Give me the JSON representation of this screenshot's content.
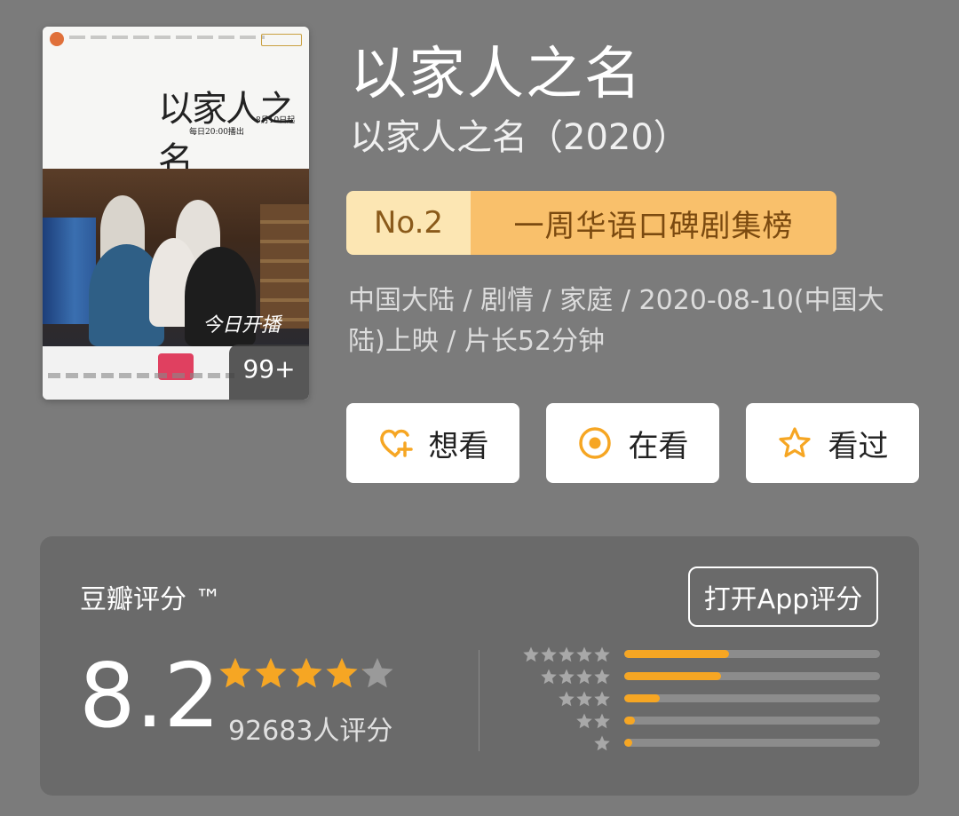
{
  "poster": {
    "title_art": "以家人之名",
    "release_note": "8月10日起",
    "airtime_note": "每日20:00播出",
    "overlay_script": "今日开播",
    "count_badge": "99+"
  },
  "header": {
    "title": "以家人之名",
    "subtitle": "以家人之名（2020）"
  },
  "rank": {
    "number": "No.2",
    "list_name": "一周华语口碑剧集榜"
  },
  "meta": "中国大陆 / 剧情 / 家庭 / 2020-08-10(中国大陆)上映 / 片长52分钟",
  "actions": {
    "want": "想看",
    "watching": "在看",
    "watched": "看过"
  },
  "rating": {
    "brand": "豆瓣评分 ™",
    "open_app": "打开App评分",
    "score": "8.2",
    "stars": 4.1,
    "raters": "92683人评分",
    "distribution": [
      {
        "stars": 5,
        "fraction": 0.41
      },
      {
        "stars": 4,
        "fraction": 0.38
      },
      {
        "stars": 3,
        "fraction": 0.14
      },
      {
        "stars": 2,
        "fraction": 0.04
      },
      {
        "stars": 1,
        "fraction": 0.03
      }
    ]
  },
  "colors": {
    "background": "#7b7b7b",
    "card": "#6a6a6a",
    "accent": "#f6a623",
    "rank_light": "#fce6b3",
    "rank_dark": "#f9c06b"
  }
}
